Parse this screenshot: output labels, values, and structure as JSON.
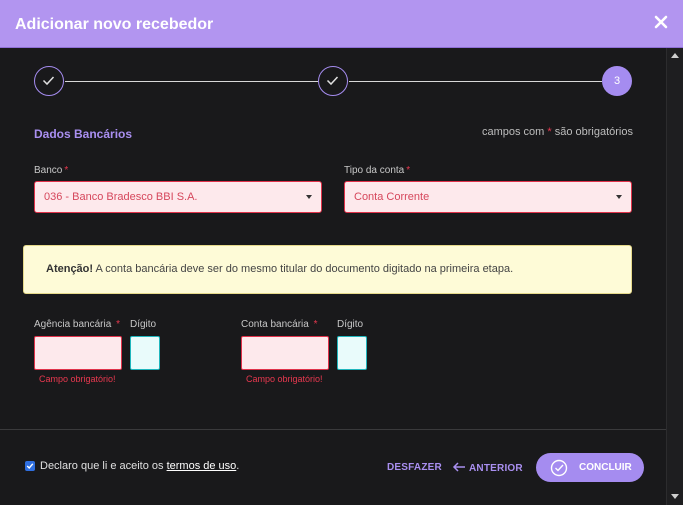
{
  "modal": {
    "title": "Adicionar novo recebedor",
    "close_icon": "close-icon"
  },
  "stepper": {
    "steps": [
      {
        "state": "done",
        "icon": "check-icon"
      },
      {
        "state": "done",
        "icon": "check-icon"
      },
      {
        "state": "active",
        "label": "3"
      }
    ]
  },
  "section": {
    "title": "Dados Bancários",
    "required_note_prefix": "campos com",
    "required_star": "*",
    "required_note_suffix": "são obrigatórios"
  },
  "bank": {
    "label": "Banco",
    "required": "*",
    "value": "036 - Banco Bradesco BBI S.A."
  },
  "account_type": {
    "label": "Tipo da conta",
    "required": "*",
    "value": "Conta Corrente"
  },
  "alert": {
    "strong": "Atenção!",
    "text": "A conta bancária deve ser do mesmo titular do documento digitado na primeira etapa."
  },
  "agency": {
    "label": "Agência bancária",
    "required": "*",
    "digit_label": "Dígito",
    "error": "Campo obrigatório!"
  },
  "account": {
    "label": "Conta bancária",
    "required": "*",
    "digit_label": "Dígito",
    "error": "Campo obrigatório!"
  },
  "footer": {
    "terms_prefix": "Declaro que li e aceito os",
    "terms_link": "termos de uso",
    "terms_suffix": ".",
    "undo": "DESFAZER",
    "previous": "ANTERIOR",
    "finish": "CONCLUIR"
  },
  "colors": {
    "header": "#b295f0",
    "accent": "#a58cf0",
    "error": "#e8384f",
    "alert_bg": "#fefbd7"
  }
}
